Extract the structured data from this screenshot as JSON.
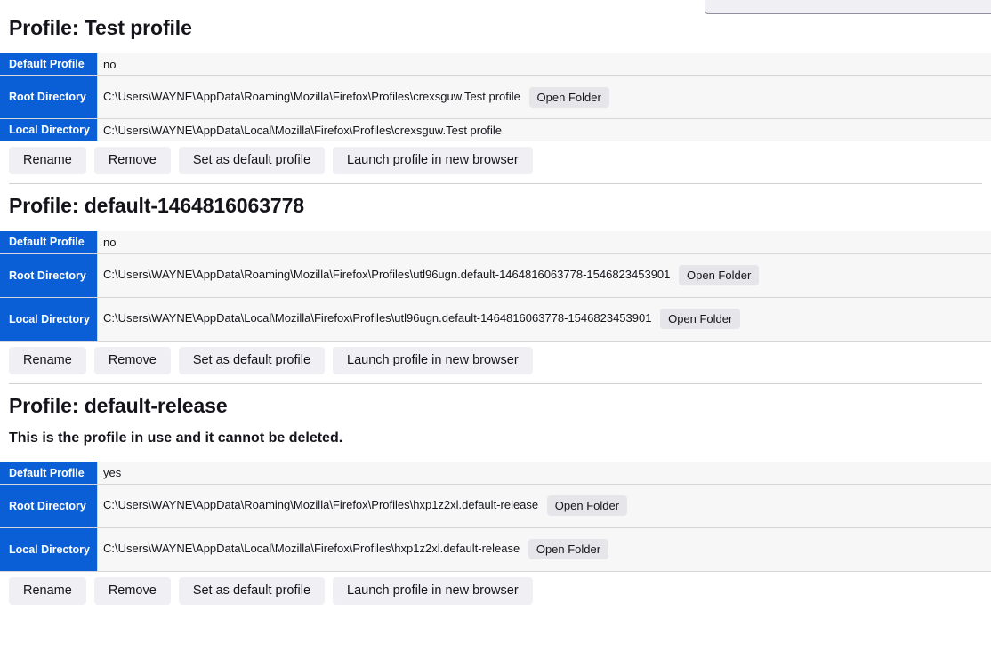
{
  "top_partial_control": {
    "label": ""
  },
  "labels": {
    "default_profile": "Default Profile",
    "root_directory": "Root Directory",
    "local_directory": "Local Directory",
    "open_folder": "Open Folder",
    "rename": "Rename",
    "remove": "Remove",
    "set_default": "Set as default profile",
    "launch": "Launch profile in new browser"
  },
  "colors": {
    "header_blue": "#0a5fd6",
    "row_bg": "#f7f7f8",
    "button_bg": "#f0f0f4",
    "open_folder_bg": "#e6e6ea",
    "text": "#15141a",
    "border": "#d7d7db"
  },
  "profiles": [
    {
      "title": "Profile: Test profile",
      "notice": null,
      "default_profile": "no",
      "root_directory": "C:\\Users\\WAYNE\\AppData\\Roaming\\Mozilla\\Firefox\\Profiles\\crexsguw.Test profile",
      "root_has_open_folder": true,
      "local_directory": "C:\\Users\\WAYNE\\AppData\\Local\\Mozilla\\Firefox\\Profiles\\crexsguw.Test profile",
      "local_has_open_folder": false
    },
    {
      "title": "Profile: default-1464816063778",
      "notice": null,
      "default_profile": "no",
      "root_directory": "C:\\Users\\WAYNE\\AppData\\Roaming\\Mozilla\\Firefox\\Profiles\\utl96ugn.default-1464816063778-1546823453901",
      "root_has_open_folder": true,
      "local_directory": "C:\\Users\\WAYNE\\AppData\\Local\\Mozilla\\Firefox\\Profiles\\utl96ugn.default-1464816063778-1546823453901",
      "local_has_open_folder": true
    },
    {
      "title": "Profile: default-release",
      "notice": "This is the profile in use and it cannot be deleted.",
      "default_profile": "yes",
      "root_directory": "C:\\Users\\WAYNE\\AppData\\Roaming\\Mozilla\\Firefox\\Profiles\\hxp1z2xl.default-release",
      "root_has_open_folder": true,
      "local_directory": "C:\\Users\\WAYNE\\AppData\\Local\\Mozilla\\Firefox\\Profiles\\hxp1z2xl.default-release",
      "local_has_open_folder": true
    }
  ]
}
